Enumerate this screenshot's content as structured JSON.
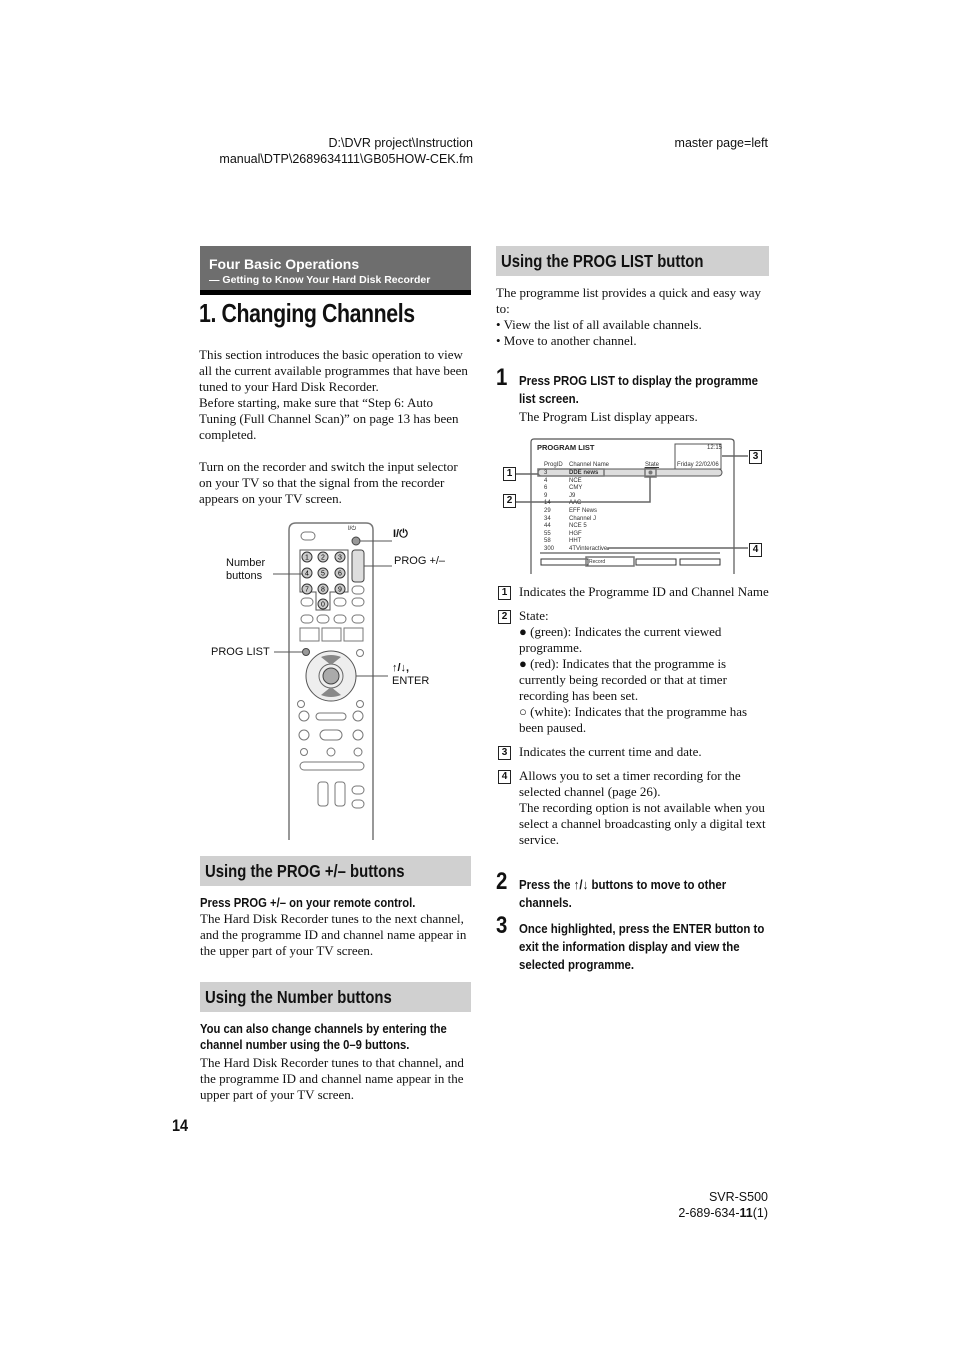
{
  "header": {
    "path_line1": "D:\\DVR project\\Instruction",
    "path_line2": "manual\\DTP\\2689634111\\GB05HOW-CEK.fm",
    "master_page": "master page=left"
  },
  "banner": {
    "title": "Four Basic Operations",
    "subtitle": "— Getting to Know Your Hard Disk Recorder"
  },
  "page_title": "1. Changing Channels",
  "intro": {
    "para1": "This section introduces the basic operation to view all the current available programmes that have been tuned to your Hard Disk Recorder.",
    "para2": "Before starting, make sure that “Step 6: Auto Tuning (Full Channel Scan)” on page 13 has been completed.",
    "para3": "Turn on the recorder and switch the input selector on your TV so that the signal from the recorder appears on your TV screen."
  },
  "remote_figure": {
    "labels": {
      "power": "I/⏻",
      "power_small": "I/⏻",
      "number_buttons": "Number buttons",
      "prog_plus_minus": "PROG +/–",
      "prog_list": "PROG LIST",
      "arrows": "↑/↓,",
      "enter": "ENTER"
    },
    "numbers": [
      "1",
      "2",
      "3",
      "4",
      "5",
      "6",
      "7",
      "8",
      "9",
      "0"
    ]
  },
  "section_prog": {
    "heading": "Using the PROG +/– buttons",
    "lead": "Press PROG +/– on your remote control.",
    "body": "The Hard Disk Recorder tunes to the next channel, and the programme ID and channel name appear in the upper part of your TV screen."
  },
  "section_number": {
    "heading": "Using the Number buttons",
    "lead": "You can also change channels by entering the channel number using the 0–9 buttons.",
    "body": "The Hard Disk Recorder tunes to that channel, and the programme ID and channel name appear in the upper part of your TV screen."
  },
  "section_proglist": {
    "heading": "Using the PROG LIST button",
    "intro": "The programme list provides a quick and easy way to:",
    "bullets": [
      "• View the list of all available channels.",
      "• Move to another channel."
    ],
    "steps": [
      {
        "num": "1",
        "title": "Press PROG LIST to display the programme list screen.",
        "detail": "The Program List display appears."
      },
      {
        "num": "2",
        "title": "Press the ↑/↓ buttons to move to other channels."
      },
      {
        "num": "3",
        "title": "Once highlighted, press the ENTER button to exit the information display and view the selected programme."
      }
    ]
  },
  "program_list_screen": {
    "title": "PROGRAM LIST",
    "time": "12:15",
    "date": "Friday 22/02/06",
    "col_progid": "ProgID",
    "col_channel": "Channel Name",
    "col_state": "State",
    "rows": [
      {
        "id": "3",
        "name": "DDE news",
        "selected": true
      },
      {
        "id": "4",
        "name": "NCE"
      },
      {
        "id": "6",
        "name": "CMY"
      },
      {
        "id": "9",
        "name": "J9"
      },
      {
        "id": "14",
        "name": "AAC"
      },
      {
        "id": "29",
        "name": "EFF  News"
      },
      {
        "id": "34",
        "name": "Channel J"
      },
      {
        "id": "44",
        "name": "NCE 5"
      },
      {
        "id": "55",
        "name": "HGF"
      },
      {
        "id": "58",
        "name": "HHT"
      },
      {
        "id": "300",
        "name": "4TVinteractive"
      }
    ],
    "record_button": "Record",
    "callouts": [
      "1",
      "2",
      "3",
      "4"
    ]
  },
  "legend": [
    {
      "num": "1",
      "text": "Indicates the Programme ID and Channel Name"
    },
    {
      "num": "2",
      "text": "State:",
      "items": [
        {
          "symbol": "●",
          "text": "(green): Indicates the current viewed programme."
        },
        {
          "symbol": "●",
          "text": "(red): Indicates that the programme is currently being recorded or that at timer recording has been set."
        },
        {
          "symbol": "○",
          "text": "(white): Indicates that the programme has been paused."
        }
      ]
    },
    {
      "num": "3",
      "text": "Indicates the current time and date."
    },
    {
      "num": "4",
      "text": "Allows you to set a timer recording for the selected channel (page 26).",
      "note": "The recording option is not available when you select a channel broadcasting only a digital text service."
    }
  ],
  "footer": {
    "page_number": "14",
    "model": "SVR-S500",
    "code_prefix": "2-689-634-",
    "code_bold": "11",
    "code_suffix": "(1)"
  }
}
